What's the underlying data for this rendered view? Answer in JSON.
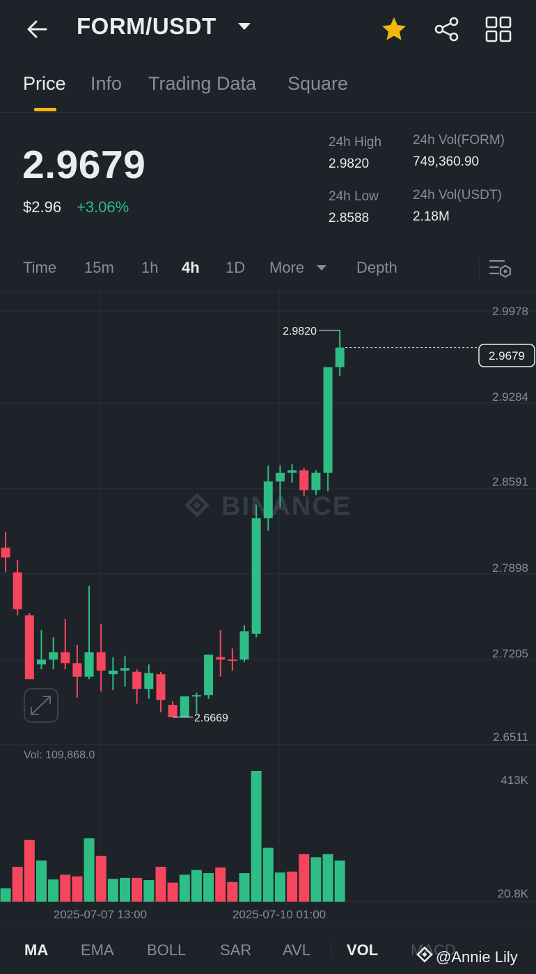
{
  "header": {
    "pair": "FORM/USDT",
    "icons": [
      "back-arrow-icon",
      "caret-down-icon",
      "star-icon",
      "share-icon",
      "grid-icon"
    ],
    "star_color": "#f0b90b"
  },
  "tabs": [
    {
      "label": "Price",
      "active": true
    },
    {
      "label": "Info",
      "active": false
    },
    {
      "label": "Trading Data",
      "active": false
    },
    {
      "label": "Square",
      "active": false
    }
  ],
  "ticker": {
    "last_price": "2.9679",
    "fiat_price": "$2.96",
    "change_pct": "+3.06%",
    "high_label": "24h High",
    "high_value": "2.9820",
    "low_label": "24h Low",
    "low_value": "2.8588",
    "vol_base_label": "24h Vol(FORM)",
    "vol_base_value": "749,360.90",
    "vol_quote_label": "24h Vol(USDT)",
    "vol_quote_value": "2.18M"
  },
  "timeframes": {
    "items": [
      "Time",
      "15m",
      "1h",
      "4h",
      "1D",
      "More",
      "Depth"
    ],
    "active": "4h"
  },
  "colors": {
    "up": "#2ebd85",
    "down": "#f6465d",
    "background": "#1e2329",
    "accent": "#f0b90b"
  },
  "chart_data": {
    "type": "candlestick",
    "price_axis_ticks": [
      "2.9978",
      "2.9284",
      "2.8591",
      "2.7898",
      "2.7205",
      "2.6511"
    ],
    "ylim": [
      2.6511,
      2.9978
    ],
    "current_price_tag": "2.9679",
    "max_marker": "2.9820",
    "min_marker": "2.6669",
    "volume_label": "Vol: 109,868.0",
    "volume_axis_ticks": [
      "413K",
      "20.8K"
    ],
    "volume_ylim": [
      20800,
      413000
    ],
    "x_labels": [
      {
        "label": "2025-07-07 13:00",
        "index": 7
      },
      {
        "label": "2025-07-10 01:00",
        "index": 22
      }
    ],
    "watermark": "BINANCE",
    "candles": [
      {
        "o": 2.805,
        "h": 2.818,
        "l": 2.785,
        "c": 2.797
      },
      {
        "o": 2.785,
        "h": 2.795,
        "l": 2.75,
        "c": 2.755
      },
      {
        "o": 2.75,
        "h": 2.752,
        "l": 2.698,
        "c": 2.698
      },
      {
        "o": 2.71,
        "h": 2.738,
        "l": 2.706,
        "c": 2.714
      },
      {
        "o": 2.714,
        "h": 2.732,
        "l": 2.706,
        "c": 2.72
      },
      {
        "o": 2.72,
        "h": 2.747,
        "l": 2.706,
        "c": 2.711
      },
      {
        "o": 2.711,
        "h": 2.726,
        "l": 2.683,
        "c": 2.7
      },
      {
        "o": 2.7,
        "h": 2.774,
        "l": 2.698,
        "c": 2.72
      },
      {
        "o": 2.72,
        "h": 2.743,
        "l": 2.688,
        "c": 2.705
      },
      {
        "o": 2.702,
        "h": 2.716,
        "l": 2.689,
        "c": 2.705
      },
      {
        "o": 2.705,
        "h": 2.717,
        "l": 2.692,
        "c": 2.707
      },
      {
        "o": 2.704,
        "h": 2.706,
        "l": 2.678,
        "c": 2.69
      },
      {
        "o": 2.69,
        "h": 2.71,
        "l": 2.682,
        "c": 2.703
      },
      {
        "o": 2.702,
        "h": 2.704,
        "l": 2.671,
        "c": 2.681
      },
      {
        "o": 2.677,
        "h": 2.68,
        "l": 2.667,
        "c": 2.667
      },
      {
        "o": 2.667,
        "h": 2.683,
        "l": 2.667,
        "c": 2.684
      },
      {
        "o": 2.684,
        "h": 2.687,
        "l": 2.67,
        "c": 2.685
      },
      {
        "o": 2.685,
        "h": 2.718,
        "l": 2.682,
        "c": 2.718
      },
      {
        "o": 2.716,
        "h": 2.738,
        "l": 2.7,
        "c": 2.714
      },
      {
        "o": 2.714,
        "h": 2.723,
        "l": 2.705,
        "c": 2.713
      },
      {
        "o": 2.714,
        "h": 2.742,
        "l": 2.712,
        "c": 2.737
      },
      {
        "o": 2.735,
        "h": 2.84,
        "l": 2.732,
        "c": 2.829
      },
      {
        "o": 2.829,
        "h": 2.872,
        "l": 2.819,
        "c": 2.859
      },
      {
        "o": 2.859,
        "h": 2.872,
        "l": 2.838,
        "c": 2.866
      },
      {
        "o": 2.866,
        "h": 2.873,
        "l": 2.858,
        "c": 2.868
      },
      {
        "o": 2.868,
        "h": 2.87,
        "l": 2.847,
        "c": 2.852
      },
      {
        "o": 2.852,
        "h": 2.868,
        "l": 2.848,
        "c": 2.866
      },
      {
        "o": 2.866,
        "h": 2.943,
        "l": 2.851,
        "c": 2.952
      },
      {
        "o": 2.952,
        "h": 2.982,
        "l": 2.945,
        "c": 2.968
      }
    ],
    "volumes": [
      {
        "v": 42000,
        "up": true
      },
      {
        "v": 110000,
        "up": false
      },
      {
        "v": 195000,
        "up": false
      },
      {
        "v": 130000,
        "up": true
      },
      {
        "v": 70000,
        "up": true
      },
      {
        "v": 85000,
        "up": false
      },
      {
        "v": 80000,
        "up": false
      },
      {
        "v": 200000,
        "up": true
      },
      {
        "v": 145000,
        "up": false
      },
      {
        "v": 72000,
        "up": true
      },
      {
        "v": 75000,
        "up": true
      },
      {
        "v": 75000,
        "up": false
      },
      {
        "v": 68000,
        "up": true
      },
      {
        "v": 110000,
        "up": false
      },
      {
        "v": 60000,
        "up": false
      },
      {
        "v": 85000,
        "up": true
      },
      {
        "v": 100000,
        "up": true
      },
      {
        "v": 90000,
        "up": true
      },
      {
        "v": 108000,
        "up": false
      },
      {
        "v": 62000,
        "up": false
      },
      {
        "v": 90000,
        "up": true
      },
      {
        "v": 413000,
        "up": true
      },
      {
        "v": 170000,
        "up": true
      },
      {
        "v": 92000,
        "up": true
      },
      {
        "v": 95000,
        "up": false
      },
      {
        "v": 150000,
        "up": false
      },
      {
        "v": 140000,
        "up": true
      },
      {
        "v": 150000,
        "up": true
      },
      {
        "v": 130000,
        "up": true
      }
    ]
  },
  "indicators": {
    "items": [
      "MA",
      "EMA",
      "BOLL",
      "SAR",
      "AVL",
      "VOL",
      "MACD"
    ],
    "active": [
      "MA",
      "VOL"
    ]
  },
  "watermark_credit": "@Annie Lily"
}
